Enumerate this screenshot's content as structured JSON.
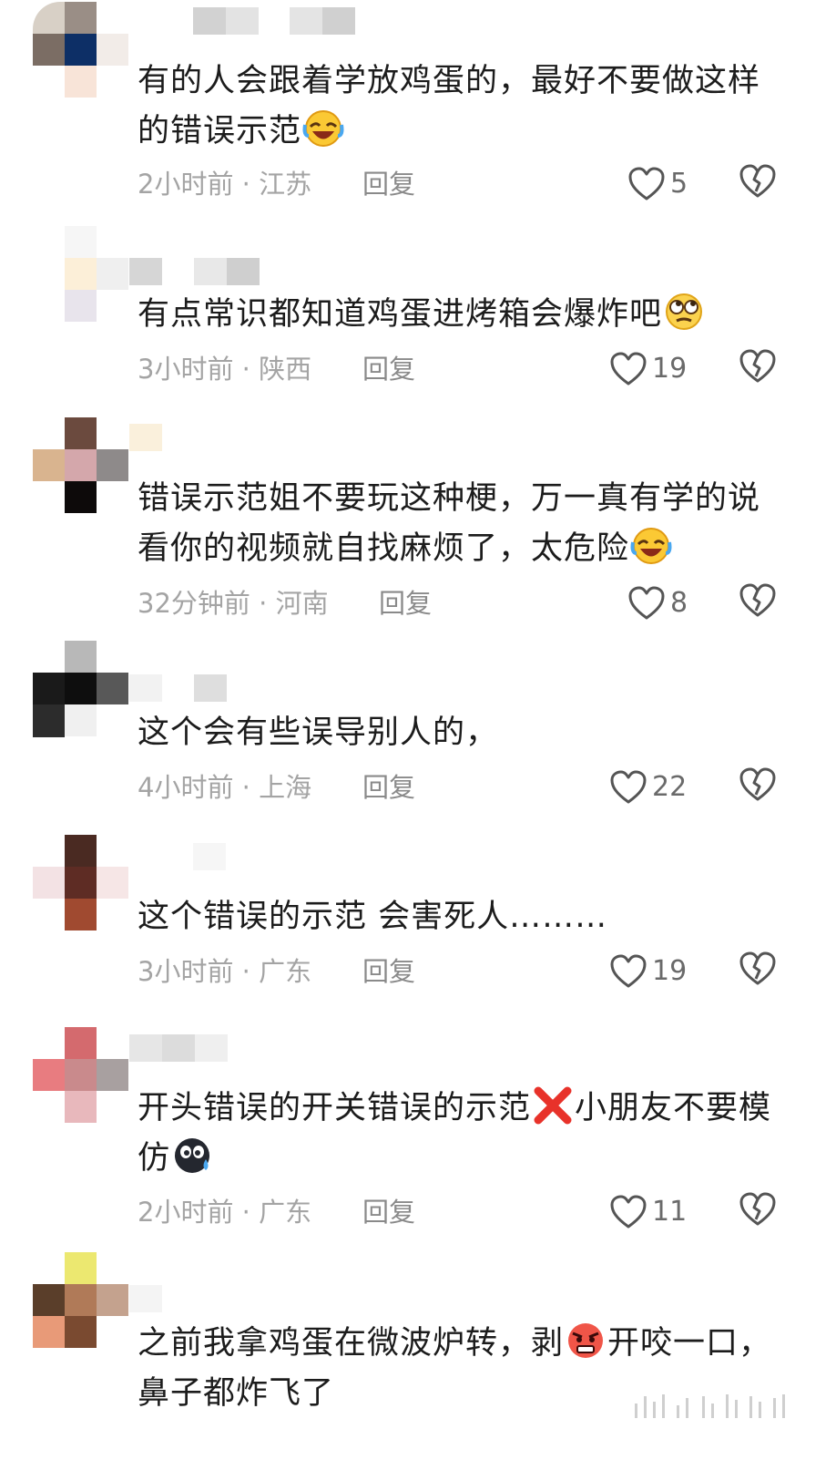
{
  "comments": [
    {
      "text": "有的人会跟着学放鸡蛋的，最好不要做这样的错误示范",
      "emoji": "rofl-emoji",
      "time": "2小时前",
      "location": "江苏",
      "reply": "回复",
      "likes": "5"
    },
    {
      "text": "有点常识都知道鸡蛋进烤箱会爆炸吧",
      "emoji": "eye-roll-emoji",
      "time": "3小时前",
      "location": "陕西",
      "reply": "回复",
      "likes": "19"
    },
    {
      "text": "错误示范姐不要玩这种梗，万一真有学的说看你的视频就自找麻烦了，太危险",
      "emoji": "rofl-emoji",
      "time": "32分钟前",
      "location": "河南",
      "reply": "回复",
      "likes": "8"
    },
    {
      "text": "这个会有些误导别人的，",
      "time": "4小时前",
      "location": "上海",
      "reply": "回复",
      "likes": "22"
    },
    {
      "text": "这个错误的示范 会害死人………",
      "time": "3小时前",
      "location": "广东",
      "reply": "回复",
      "likes": "19"
    },
    {
      "text_before": "开头错误的开关错误的示范",
      "text_after": "小朋友不要模仿",
      "emoji_mid": "cross-mark-emoji",
      "emoji": "sweat-face-emoji",
      "time": "2小时前",
      "location": "广东",
      "reply": "回复",
      "likes": "11"
    },
    {
      "text_before": "之前我拿鸡蛋在微波炉转，剥",
      "text_after": "开咬一口，鼻子都炸飞了",
      "emoji_mid": "angry-face-emoji"
    }
  ],
  "colors": {
    "text": "#1c1c1c",
    "meta": "#a4a4a4",
    "reply": "#8a8a8a",
    "icon": "#555555",
    "background": "#ffffff"
  },
  "icons": {
    "like": "heart-outline-icon",
    "dislike": "broken-heart-icon"
  }
}
